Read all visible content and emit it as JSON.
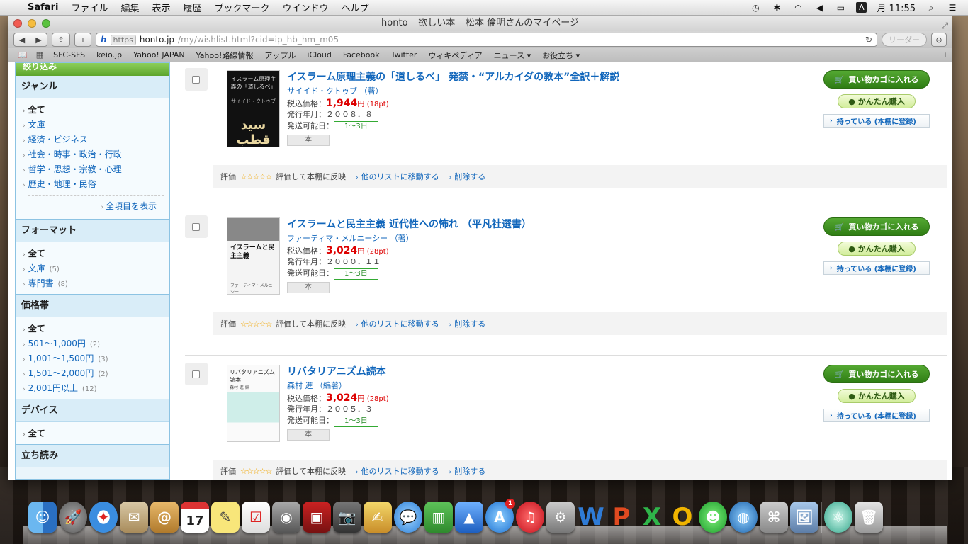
{
  "menubar": {
    "app": "Safari",
    "items": [
      "ファイル",
      "編集",
      "表示",
      "履歴",
      "ブックマーク",
      "ウインドウ",
      "ヘルプ"
    ],
    "input_indicator": "A",
    "clock": "月 11:55"
  },
  "window": {
    "title": "honto – 欲しい本 – 松本 倫明さんのマイページ",
    "url_scheme": "https",
    "url_domain": "honto.jp",
    "url_path": "/my/wishlist.html?cid=ip_hb_hm_m05",
    "reader": "リーダー"
  },
  "bookmarks": [
    "SFC-SFS",
    "keio.jp",
    "Yahoo! JAPAN",
    "Yahoo!路線情報",
    "アップル",
    "iCloud",
    "Facebook",
    "Twitter",
    "ウィキペディア",
    "ニュース ▾",
    "お役立ち ▾"
  ],
  "sidebar": {
    "top_label": "絞り込み",
    "genre": {
      "heading": "ジャンル",
      "items": [
        "全て",
        "文庫",
        "経済・ビジネス",
        "社会・時事・政治・行政",
        "哲学・思想・宗教・心理",
        "歴史・地理・民俗"
      ],
      "more": "全項目を表示"
    },
    "format": {
      "heading": "フォーマット",
      "items": [
        {
          "label": "全て",
          "count": ""
        },
        {
          "label": "文庫",
          "count": "(5)"
        },
        {
          "label": "専門書",
          "count": "(8)"
        }
      ]
    },
    "price": {
      "heading": "価格帯",
      "items": [
        {
          "label": "全て",
          "count": ""
        },
        {
          "label": "501〜1,000円",
          "count": "(2)"
        },
        {
          "label": "1,001〜1,500円",
          "count": "(3)"
        },
        {
          "label": "1,501〜2,000円",
          "count": "(2)"
        },
        {
          "label": "2,001円以上",
          "count": "(12)"
        }
      ]
    },
    "device": {
      "heading": "デバイス",
      "items": [
        "全て"
      ]
    },
    "preview": {
      "heading": "立ち読み"
    }
  },
  "labels": {
    "price_label": "税込価格：",
    "date_label": "発行年月：",
    "ship_label": "発送可能日：",
    "yen": "円",
    "cart": "買い物カゴに入れる",
    "easy": "かんたん購入",
    "own": "持っている (本棚に登録)",
    "rating": "評価",
    "stars": "☆☆☆☆☆",
    "reflect": "評価して本棚に反映",
    "move": "他のリストに移動する",
    "delete": "削除する"
  },
  "products": [
    {
      "title": "イスラーム原理主義の「道しるべ」 発禁・“アルカイダの教本”全訳＋解説",
      "author": "サイイド・クトゥブ （著）",
      "price": "1,944",
      "points": "(18pt)",
      "date": "２００８．８",
      "ship": "1〜3日",
      "type": "本",
      "cover_text": "イスラーム原理主義の「道しるべ」",
      "cover_sub": "サイイド・クトゥブ",
      "cover_arabic": "سيد قطب"
    },
    {
      "title": "イスラームと民主主義 近代性への怖れ （平凡社選書）",
      "author": "ファーティマ・メルニーシー （著）",
      "price": "3,024",
      "points": "(28pt)",
      "date": "２０００．１１",
      "ship": "1〜3日",
      "type": "本",
      "cover_text": "イスラームと民主主義",
      "cover_sub": "ファーティマ・メルニーシー"
    },
    {
      "title": "リバタリアニズム読本",
      "author": "森村 進 （編著）",
      "price": "3,024",
      "points": "(28pt)",
      "date": "２００５．３",
      "ship": "1〜3日",
      "type": "本",
      "cover_text": "リバタリアニズム読本",
      "cover_sub": "森村 進 編"
    }
  ],
  "dock": {
    "calendar_day": "17",
    "app_store_badge": "1",
    "office_letters": [
      "W",
      "P",
      "X",
      "O"
    ]
  },
  "colors": {
    "link": "#1166bb",
    "price": "#dd0000",
    "cart_button": "#3f901f",
    "sidebar_bg": "#eaf5fb"
  }
}
